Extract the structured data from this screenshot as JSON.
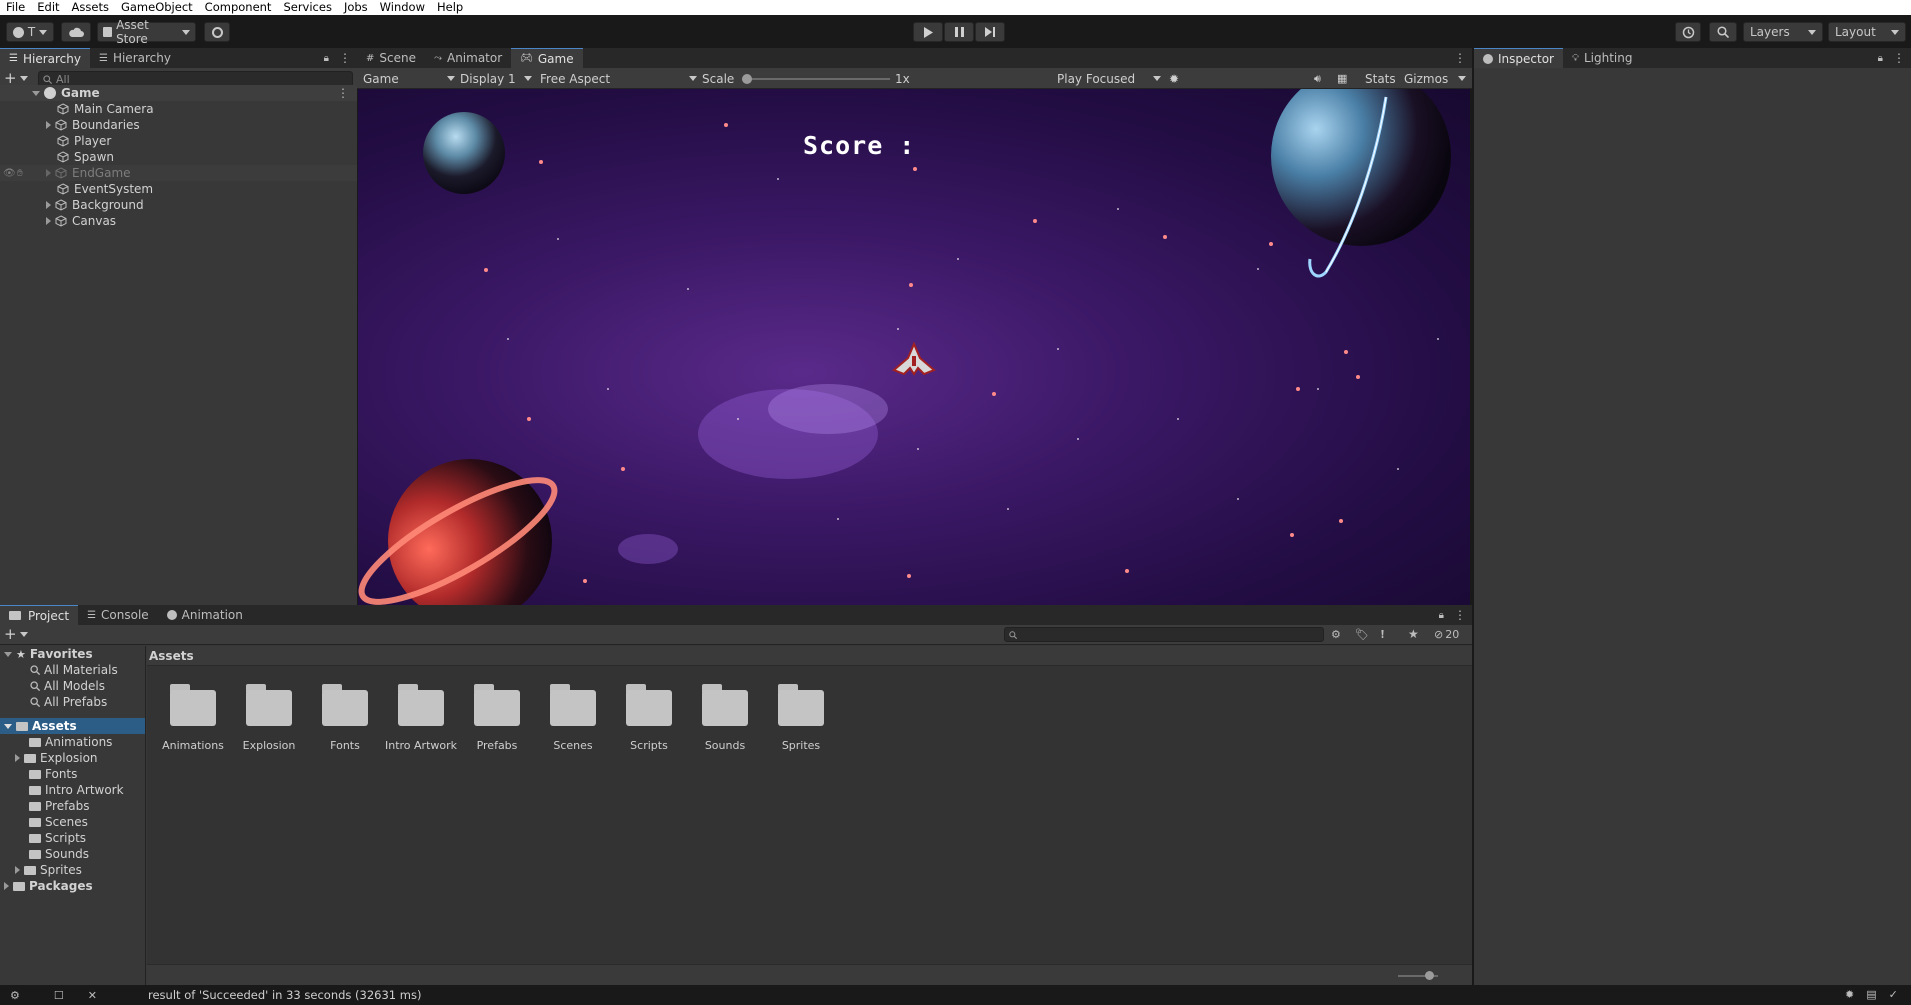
{
  "menu": [
    "File",
    "Edit",
    "Assets",
    "GameObject",
    "Component",
    "Services",
    "Jobs",
    "Window",
    "Help"
  ],
  "toolbar": {
    "account_label": "T",
    "asset_store_label": "Asset Store",
    "layers_label": "Layers",
    "layout_label": "Layout"
  },
  "hierarchy": {
    "tabs": [
      "Hierarchy",
      "Hierarchy"
    ],
    "search_placeholder": "All",
    "scene_name": "Game",
    "items": [
      "Main Camera",
      "Boundaries",
      "Player",
      "Spawn",
      "EndGame",
      "EventSystem",
      "Background",
      "Canvas"
    ]
  },
  "scene_tabs": [
    "Scene",
    "Animator",
    "Game"
  ],
  "game_bar": {
    "mode": "Game",
    "display": "Display 1",
    "aspect": "Free Aspect",
    "scale_label": "Scale",
    "scale_value": "1x",
    "play_focused": "Play Focused",
    "stats": "Stats",
    "gizmos": "Gizmos"
  },
  "game_view": {
    "score_label": "Score :"
  },
  "inspector_tabs": [
    "Inspector",
    "Lighting"
  ],
  "bottom_tabs": [
    "Project",
    "Console",
    "Animation"
  ],
  "project": {
    "favorites_label": "Favorites",
    "favorites": [
      "All Materials",
      "All Models",
      "All Prefabs"
    ],
    "assets_label": "Assets",
    "asset_folders": [
      "Animations",
      "Explosion",
      "Fonts",
      "Intro Artwork",
      "Prefabs",
      "Scenes",
      "Scripts",
      "Sounds",
      "Sprites"
    ],
    "packages_label": "Packages",
    "breadcrumb": "Assets",
    "grid_folders": [
      "Animations",
      "Explosion",
      "Fonts",
      "Intro Artwork",
      "Prefabs",
      "Scenes",
      "Scripts",
      "Sounds",
      "Sprites"
    ],
    "hidden_count": "20"
  },
  "status": {
    "message": "result of 'Succeeded' in 33 seconds (32631 ms)"
  },
  "colors": {
    "accent": "#4a86c8",
    "selection": "#2c5d87",
    "panel": "#383838",
    "background": "#191919"
  }
}
